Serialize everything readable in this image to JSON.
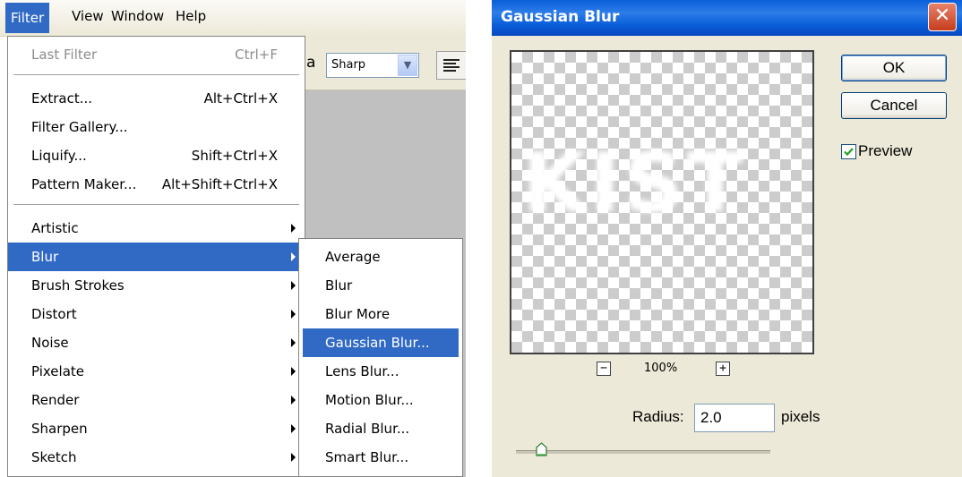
{
  "menubar": {
    "items": [
      {
        "label": "Filter",
        "active": true
      },
      {
        "label": "View",
        "active": false
      },
      {
        "label": "Window",
        "active": false
      },
      {
        "label": "Help",
        "active": false
      }
    ]
  },
  "toolbar": {
    "aa_glyph": "a",
    "antialias_value": "Sharp"
  },
  "filter_menu": {
    "items": [
      {
        "label": "Last Filter",
        "shortcut": "Ctrl+F",
        "disabled": true
      },
      {
        "label": "Extract...",
        "shortcut": "Alt+Ctrl+X"
      },
      {
        "label": "Filter Gallery...",
        "shortcut": ""
      },
      {
        "label": "Liquify...",
        "shortcut": "Shift+Ctrl+X"
      },
      {
        "label": "Pattern Maker...",
        "shortcut": "Alt+Shift+Ctrl+X"
      },
      {
        "label": "Artistic",
        "submenu": true
      },
      {
        "label": "Blur",
        "submenu": true,
        "highlighted": true
      },
      {
        "label": "Brush Strokes",
        "submenu": true
      },
      {
        "label": "Distort",
        "submenu": true
      },
      {
        "label": "Noise",
        "submenu": true
      },
      {
        "label": "Pixelate",
        "submenu": true
      },
      {
        "label": "Render",
        "submenu": true
      },
      {
        "label": "Sharpen",
        "submenu": true
      },
      {
        "label": "Sketch",
        "submenu": true
      }
    ]
  },
  "blur_submenu": {
    "items": [
      {
        "label": "Average"
      },
      {
        "label": "Blur"
      },
      {
        "label": "Blur More"
      },
      {
        "label": "Gaussian Blur...",
        "highlighted": true
      },
      {
        "label": "Lens Blur..."
      },
      {
        "label": "Motion Blur..."
      },
      {
        "label": "Radial Blur..."
      },
      {
        "label": "Smart Blur..."
      }
    ]
  },
  "dialog": {
    "title": "Gaussian Blur",
    "close_glyph": "✕",
    "preview_text": "KIST",
    "ok_label": "OK",
    "cancel_label": "Cancel",
    "preview_label": "Preview",
    "preview_checked": true,
    "zoom_out_glyph": "−",
    "zoom_in_glyph": "+",
    "zoom_level": "100%",
    "radius_label": "Radius:",
    "radius_value": "2.0",
    "radius_unit": "pixels",
    "colors": {
      "titlebar": "#0a5ed8",
      "close": "#c63d1d",
      "highlight": "#316ac5"
    }
  }
}
